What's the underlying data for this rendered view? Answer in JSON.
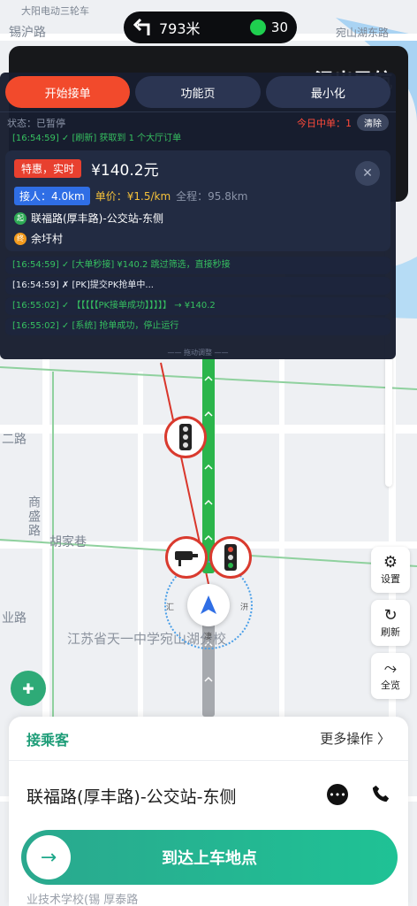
{
  "status_bar": {
    "turn_distance": "793米",
    "traffic_light_count": "30"
  },
  "map_labels": {
    "top_left": "大阳电动三轮车",
    "street_xihu": "锡沪路",
    "right_top": "宛山湖东路",
    "road_left": "二路",
    "shangsheng": "商盛路",
    "hujia": "胡家巷",
    "road_ji": "业路",
    "school": "江苏省天一中学宛山湖分校",
    "bottom_street": "业技术学校(锡  厚泰路"
  },
  "nav_header": {
    "destination": "温出导航"
  },
  "overlay": {
    "tabs": [
      "开始接单",
      "功能页",
      "最小化"
    ],
    "status": "状态：已暂停",
    "today": "今日中单：1",
    "clear": "清除",
    "log_top": "[16:54:59] ✓ [刷新] 获取到 1 个大厅订单",
    "order": {
      "tag": "特惠，实时",
      "price": "¥140.2元",
      "pickup": "接人：4.0km",
      "unit_price": "单价：¥1.5/km",
      "total": "全程：95.8km",
      "start_pin": "起",
      "start_addr": "联福路(厚丰路)-公交站-东侧",
      "end_pin": "终",
      "end_addr": "余圩村",
      "close": "✕"
    },
    "logs": [
      {
        "text": "[16:54:59] ✓ [大单秒接] ¥140.2 跳过筛选，直接秒接",
        "color": "green"
      },
      {
        "text": "[16:54:59] ✗ [PK]提交PK抢单中...",
        "color": "white"
      },
      {
        "text": "[16:55:02] ✓ 【【【【【PK接单成功】】】】】 → ¥140.2",
        "color": "green"
      },
      {
        "text": "[16:55:02] ✓ [系统] 抢单成功，停止运行",
        "color": "green"
      }
    ],
    "drag_hint": "—— 拖动调整 ——"
  },
  "side_buttons": {
    "settings": "设置",
    "refresh": "刷新",
    "overview": "全览"
  },
  "car_dirs": {
    "left": "汇",
    "right": "汧",
    "bottom": "凄"
  },
  "bottom_card": {
    "title": "接乘客",
    "more": "更多操作 〉",
    "address": "联福路(厚丰路)-公交站-东侧",
    "arrive_button": "到达上车地点"
  },
  "colors": {
    "accent_green": "#1fc295",
    "tab_active": "#f24a2c",
    "route_green": "#2bb54b"
  }
}
